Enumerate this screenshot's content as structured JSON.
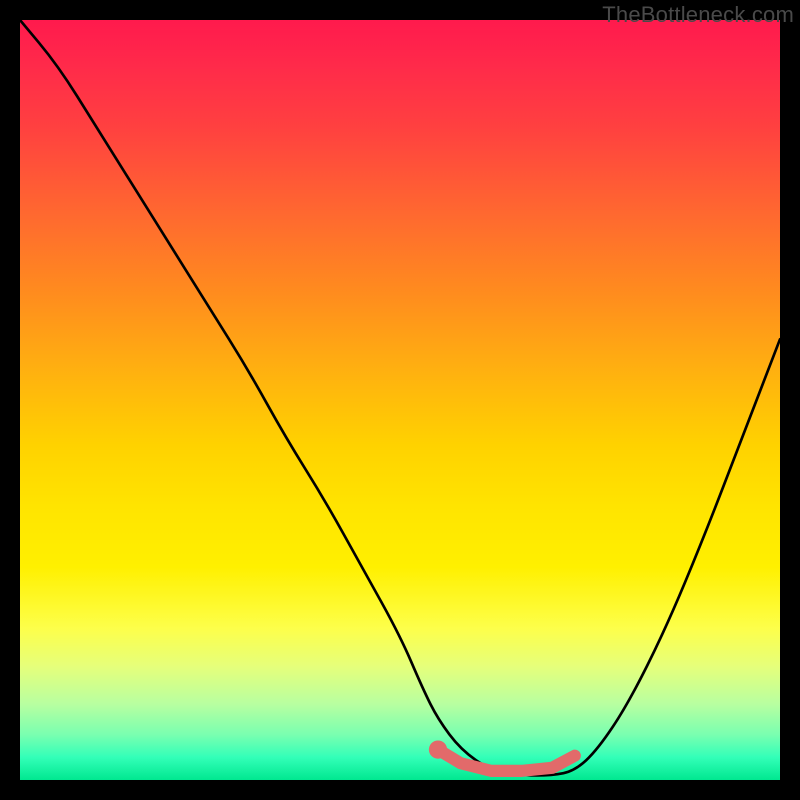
{
  "watermark": "TheBottleneck.com",
  "chart_data": {
    "type": "line",
    "title": "",
    "xlabel": "",
    "ylabel": "",
    "xlim": [
      0,
      100
    ],
    "ylim": [
      0,
      100
    ],
    "grid": false,
    "legend": false,
    "series": [
      {
        "name": "bottleneck-curve",
        "color": "#000000",
        "x": [
          0,
          5,
          10,
          15,
          20,
          25,
          30,
          35,
          40,
          45,
          50,
          53,
          55,
          58,
          62,
          66,
          70,
          73,
          76,
          80,
          85,
          90,
          95,
          100
        ],
        "y": [
          100,
          94,
          86,
          78,
          70,
          62,
          54,
          45,
          37,
          28,
          19,
          12,
          8,
          4,
          1.2,
          0.6,
          0.6,
          1.2,
          4,
          10,
          20,
          32,
          45,
          58
        ]
      },
      {
        "name": "optimal-band",
        "color": "#e26a6a",
        "x": [
          55,
          58,
          62,
          66,
          70,
          73
        ],
        "y": [
          4.0,
          2.2,
          1.2,
          1.2,
          1.6,
          3.2
        ]
      }
    ],
    "markers": [
      {
        "name": "optimal-start-dot",
        "x": 55,
        "y": 4.0,
        "r": 1.2,
        "color": "#e26a6a"
      }
    ],
    "colors": {
      "gradient_top": "#ff1a4d",
      "gradient_mid": "#ffd200",
      "gradient_bottom": "#00e890",
      "curve": "#000000",
      "band": "#e26a6a",
      "background": "#000000"
    }
  }
}
